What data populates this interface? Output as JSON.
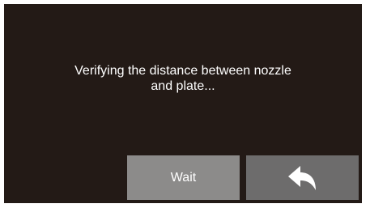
{
  "dialog": {
    "message_line1": "Verifying the distance between nozzle",
    "message_line2": "and plate..."
  },
  "buttons": {
    "wait_label": "Wait",
    "back_icon": "back-arrow-icon"
  },
  "colors": {
    "screen_background": "#231a16",
    "wait_button": "#8c8b8a",
    "back_button": "#6d6c6c",
    "text": "#ffffff"
  }
}
